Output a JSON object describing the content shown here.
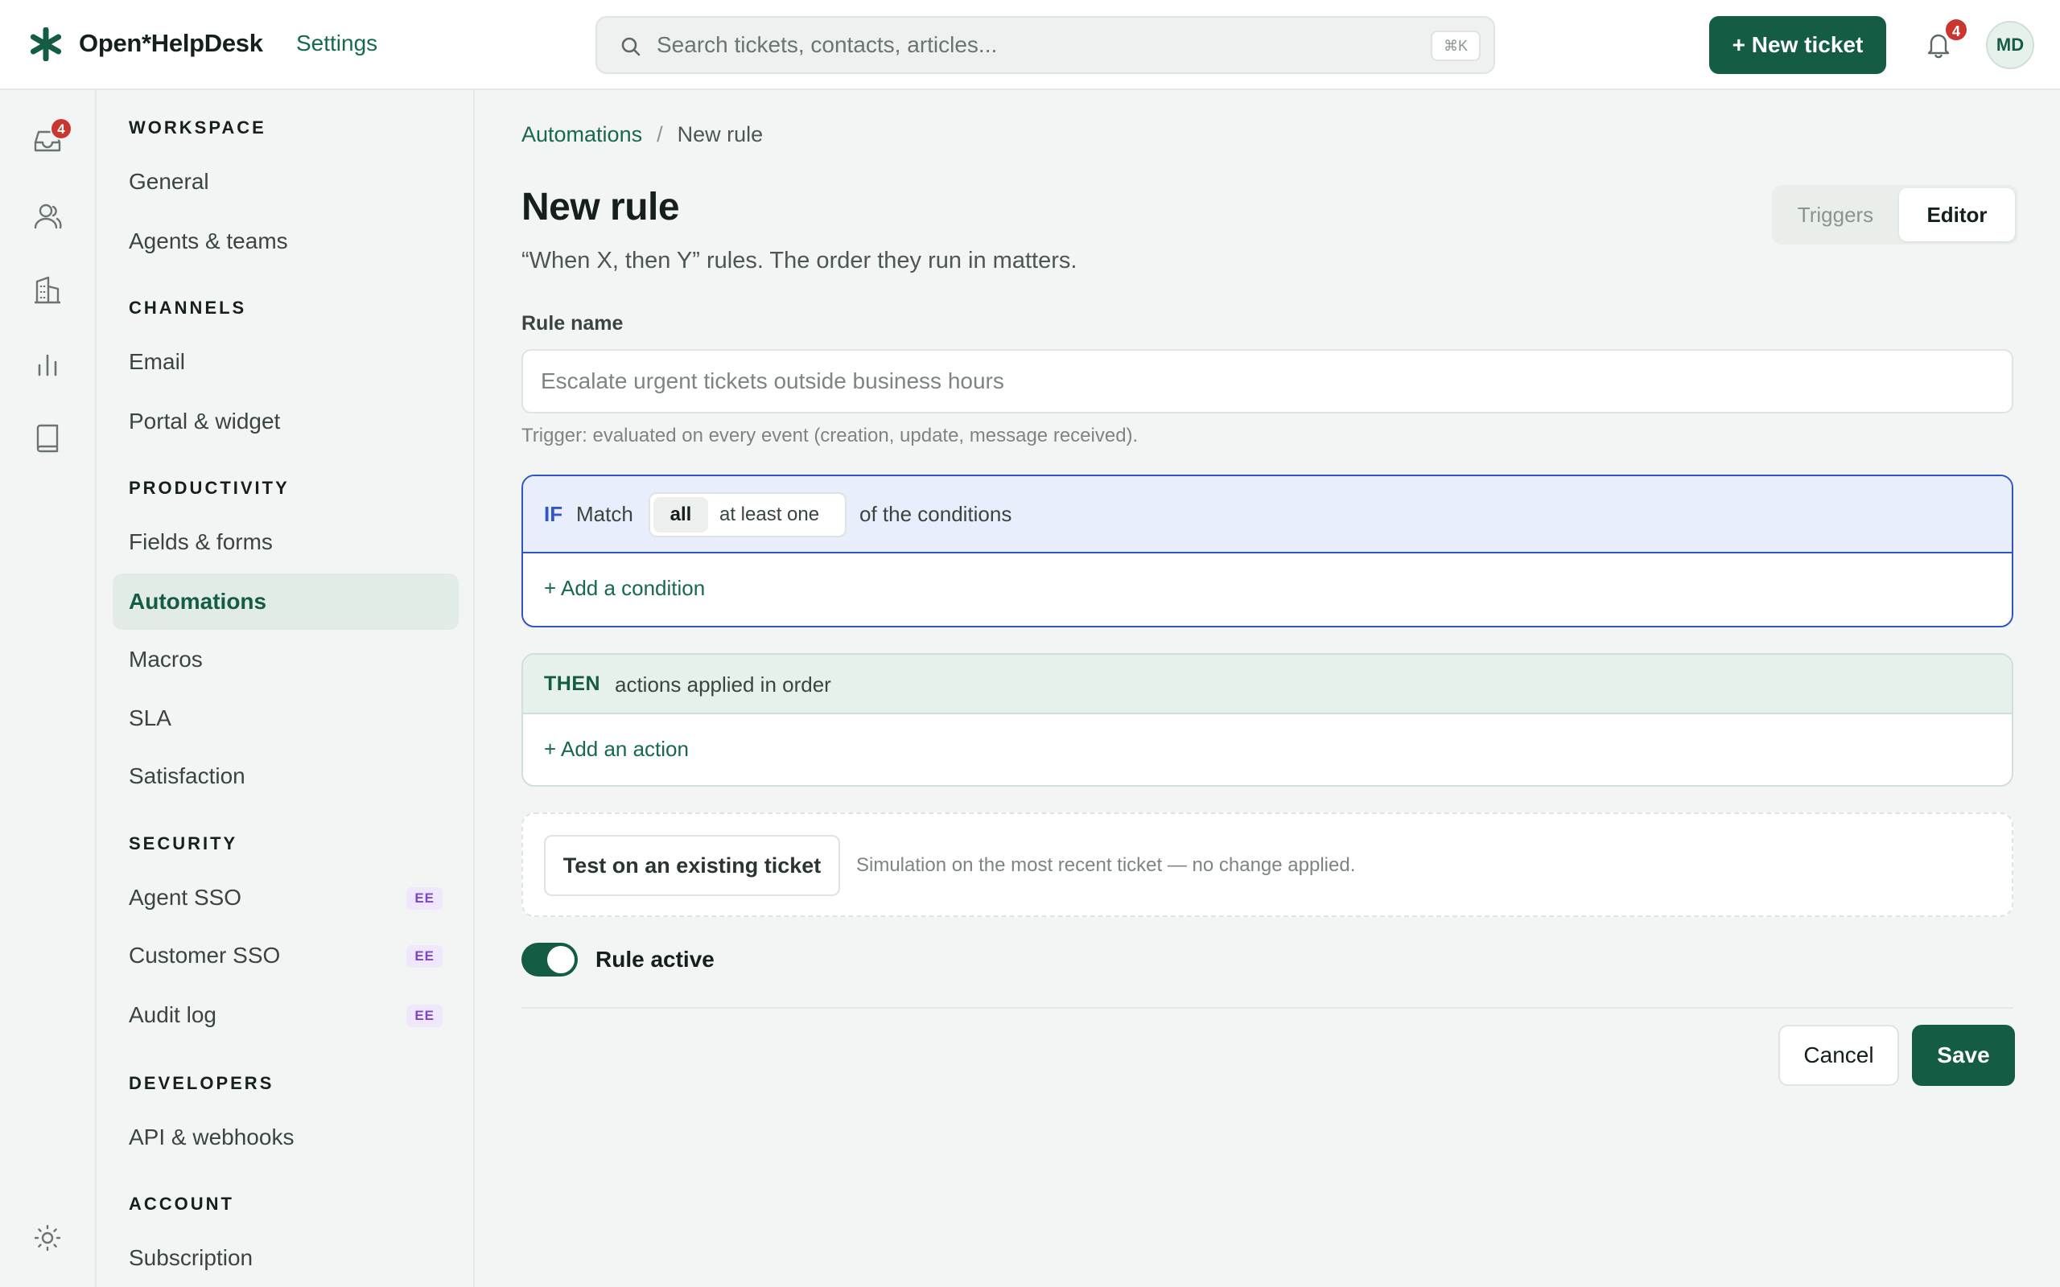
{
  "app": {
    "brand": "Open*HelpDesk",
    "section": "Settings"
  },
  "search": {
    "placeholder": "Search tickets, contacts, articles...",
    "shortcut": "⌘K"
  },
  "header": {
    "new_ticket_label": "+ New ticket",
    "notification_count": "4",
    "avatar_initials": "MD"
  },
  "rail": {
    "inbox_badge": "4",
    "icons": [
      "inbox-icon",
      "contacts-icon",
      "organizations-icon",
      "reports-icon",
      "knowledge-base-icon",
      "theme-icon"
    ]
  },
  "sidebar": {
    "sections": [
      {
        "title": "WORKSPACE",
        "items": [
          {
            "label": "General"
          },
          {
            "label": "Agents & teams"
          }
        ]
      },
      {
        "title": "CHANNELS",
        "items": [
          {
            "label": "Email"
          },
          {
            "label": "Portal & widget"
          }
        ]
      },
      {
        "title": "PRODUCTIVITY",
        "items": [
          {
            "label": "Fields & forms"
          },
          {
            "label": "Automations",
            "active": true
          },
          {
            "label": "Macros"
          },
          {
            "label": "SLA"
          },
          {
            "label": "Satisfaction"
          }
        ]
      },
      {
        "title": "SECURITY",
        "items": [
          {
            "label": "Agent SSO",
            "badge": "EE"
          },
          {
            "label": "Customer SSO",
            "badge": "EE"
          },
          {
            "label": "Audit log",
            "badge": "EE"
          }
        ]
      },
      {
        "title": "DEVELOPERS",
        "items": [
          {
            "label": "API & webhooks"
          }
        ]
      },
      {
        "title": "ACCOUNT",
        "items": [
          {
            "label": "Subscription"
          }
        ]
      }
    ]
  },
  "breadcrumb": {
    "parent": "Automations",
    "separator": "/",
    "current": "New rule"
  },
  "page": {
    "title": "New rule",
    "subtitle": "“When X, then Y” rules. The order they run in matters."
  },
  "view_toggle": {
    "options": [
      "Triggers",
      "Editor"
    ],
    "selected": "Editor"
  },
  "form": {
    "rule_name_label": "Rule name",
    "rule_name_value": "",
    "rule_name_placeholder": "Escalate urgent tickets outside business hours",
    "trigger_hint": "Trigger: evaluated on every event (creation, update, message received)."
  },
  "conditions": {
    "keyword": "IF",
    "match_label": "Match",
    "match_options": [
      "all",
      "at least one"
    ],
    "match_selected": "all",
    "suffix": "of the conditions",
    "add_label": "+ Add a condition"
  },
  "actions": {
    "keyword": "THEN",
    "subtitle": "actions applied in order",
    "add_label": "+ Add an action"
  },
  "test": {
    "button_label": "Test on an existing ticket",
    "note": "Simulation on the most recent ticket — no change applied."
  },
  "active_toggle": {
    "label": "Rule active",
    "on": true
  },
  "footer": {
    "cancel_label": "Cancel",
    "save_label": "Save"
  },
  "colors": {
    "brand_green": "#145c44",
    "condition_blue": "#2f55c9",
    "badge_red": "#c9362f",
    "ee_purple": "#7b47c6"
  }
}
